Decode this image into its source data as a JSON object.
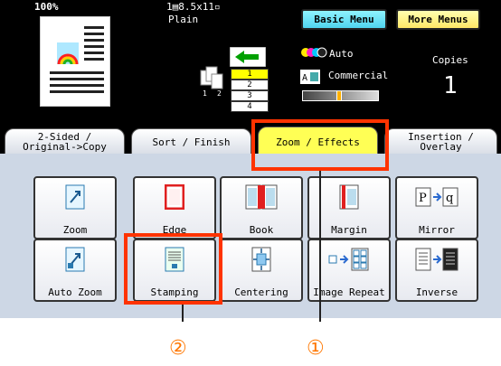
{
  "status": {
    "zoom": "100%",
    "paper_size": "1▤8.5x11▫",
    "paper_type": "Plain",
    "trays": [
      "1",
      "2",
      "3",
      "4"
    ],
    "selected_tray": "1",
    "color_mode": "Auto",
    "copies_label": "Copies",
    "image_quality": "Commercial",
    "copies_count": "1"
  },
  "top_buttons": {
    "basic_menu": "Basic Menu",
    "more_menus": "More Menus"
  },
  "tabs": [
    {
      "line1": "2-Sided /",
      "line2": "Original->Copy"
    },
    {
      "line1": "Sort / Finish",
      "line2": ""
    },
    {
      "line1": "Zoom / Effects",
      "line2": ""
    },
    {
      "line1": "Insertion /",
      "line2": "Overlay"
    }
  ],
  "features": {
    "zoom": "Zoom",
    "edge": "Edge",
    "book": "Book",
    "margin": "Margin",
    "mirror": "Mirror",
    "auto_zoom": "Auto Zoom",
    "stamping": "Stamping",
    "centering": "Centering",
    "image_repeat": "Image Repeat",
    "inverse": "Inverse"
  },
  "callouts": {
    "first": "①",
    "second": "②"
  },
  "colors": {
    "highlight": "#ff3300",
    "active_tab": "#ffff55",
    "callout": "#ff7700"
  }
}
